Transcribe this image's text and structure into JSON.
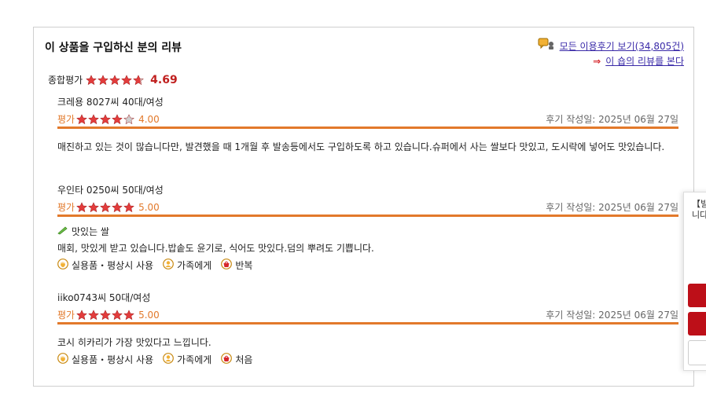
{
  "section": {
    "title": "이 상품을 구입하신 분의 리뷰",
    "all_reviews_link": "모든 이용후기 보기(34,805건)",
    "shop_reviews_link": "이 숍의 리뷰를 본다",
    "arrow": "⇒"
  },
  "overall": {
    "label": "종합평가",
    "score": "4.69",
    "rating": 4.69
  },
  "rating_label": "평가",
  "date_label": "후기 작성일: 2025년 06월 27일",
  "reviews": [
    {
      "reviewer": "크레용 8027씨 40대/여성",
      "rating": 4,
      "score": "4.00",
      "headline": "",
      "body": "매진하고 있는 것이 많습니다만, 발견했을 때 1개월 후 발송등에서도 구입하도록 하고 있습니다.슈퍼에서 사는 쌀보다 맛있고, 도시락에 넣어도 맛있습니다."
    },
    {
      "reviewer": "우인타 0250씨 50대/여성",
      "rating": 5,
      "score": "5.00",
      "headline": "맛있는 쌀",
      "body": "매회, 맛있게 받고 있습니다.밥솥도 윤기로, 식어도 맛있다.덤의 뿌려도 기쁩니다.",
      "tags": [
        "실용품・평상시 사용",
        "가족에게",
        "반복"
      ]
    },
    {
      "reviewer": "iiko0743씨 50대/여성",
      "rating": 5,
      "score": "5.00",
      "headline": "",
      "body": "코시 히카리가 가장 맛있다고 느낍니다.",
      "tags": [
        "실용품・평상시 사용",
        "가족에게",
        "처음"
      ]
    }
  ],
  "side_panel": {
    "text": "【빌\n니다"
  },
  "colors": {
    "accent": "#e2792b",
    "star": "#e23c3c",
    "score_red": "#c0201f",
    "link": "#3a2aa8",
    "side_button": "#bd0f18"
  }
}
